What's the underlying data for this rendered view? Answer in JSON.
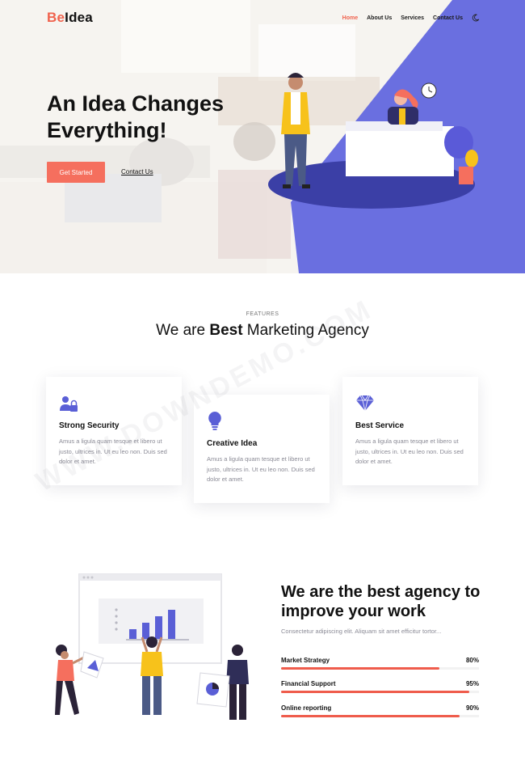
{
  "brand": {
    "logo_accent": "Be",
    "logo_rest": "Idea",
    "accent_color": "#f0624d",
    "primary_purple": "#6a6fe0"
  },
  "nav": {
    "items": [
      {
        "label": "Home",
        "active": true
      },
      {
        "label": "About Us",
        "active": false
      },
      {
        "label": "Services",
        "active": false
      },
      {
        "label": "Contact Us",
        "active": false
      }
    ],
    "theme_toggle_icon": "moon-icon"
  },
  "hero": {
    "title": "An Idea Changes Everything!",
    "primary_button": "Get Started",
    "secondary_link": "Contact Us"
  },
  "features": {
    "eyebrow": "FEATURES",
    "title_prefix": "We are ",
    "title_bold": "Best",
    "title_suffix": " Marketing Agency",
    "cards": [
      {
        "icon": "user-lock-icon",
        "title": "Strong Security",
        "text": "Amus a ligula quam tesque et libero ut justo, ultrices in. Ut eu leo non. Duis sed dolor et amet."
      },
      {
        "icon": "lightbulb-icon",
        "title": "Creative Idea",
        "text": "Amus a ligula quam tesque et libero ut justo, ultrices in. Ut eu leo non. Duis sed dolor et amet."
      },
      {
        "icon": "diamond-icon",
        "title": "Best Service",
        "text": "Amus a ligula quam tesque et libero ut justo, ultrices in. Ut eu leo non. Duis sed dolor et amet."
      }
    ]
  },
  "about": {
    "title_bold": "We are",
    "title_rest": " the best agency to improve your work",
    "subtitle": "Consectetur adipiscing elit. Aliquam sit amet efficitur tortor...",
    "skills": [
      {
        "label": "Market Strategy",
        "percent_text": "80%",
        "value": 80
      },
      {
        "label": "Financial Support",
        "percent_text": "95%",
        "value": 95
      },
      {
        "label": "Online reporting",
        "percent_text": "90%",
        "value": 90
      }
    ]
  },
  "watermark": {
    "text": "WWW.DOWNDEMO.COM"
  }
}
